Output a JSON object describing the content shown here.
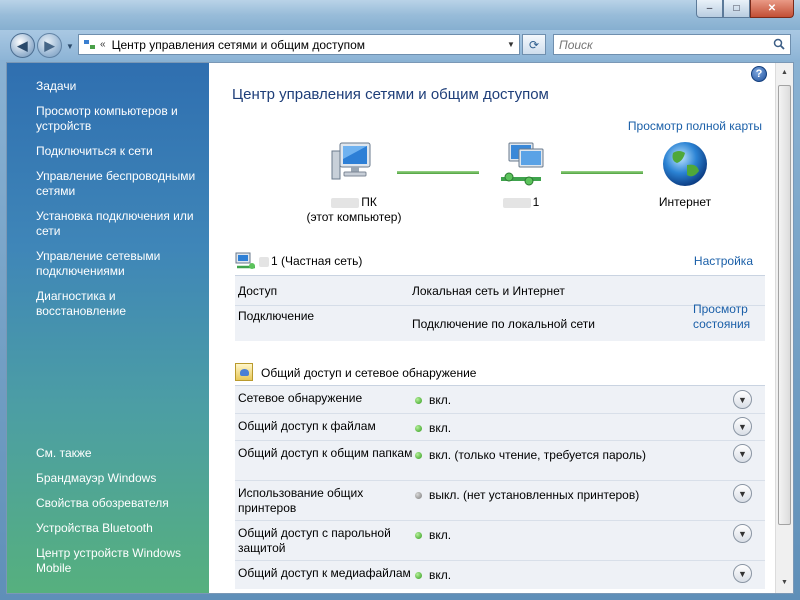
{
  "titlebar": {
    "min": "–",
    "max": "□",
    "close": "✕"
  },
  "nav": {
    "back": "◀",
    "forward": "▶",
    "dropdown": "▼",
    "address_sep": "«",
    "address": "Центр управления сетями и общим доступом",
    "refresh": "⟳",
    "search_placeholder": "Поиск"
  },
  "sidebar": {
    "heading": "Задачи",
    "items": [
      "Просмотр компьютеров и устройств",
      "Подключиться к сети",
      "Управление беспроводными сетями",
      "Установка подключения или сети",
      "Управление сетевыми подключениями",
      "Диагностика и восстановление"
    ],
    "see_also": "См. также",
    "see_items": [
      "Брандмауэр Windows",
      "Свойства обозревателя",
      "Устройства Bluetooth",
      "Центр устройств Windows Mobile"
    ]
  },
  "main": {
    "help": "?",
    "title": "Центр управления сетями и общим доступом",
    "full_map": "Просмотр полной карты",
    "map": {
      "pc_name": "ПК",
      "pc_sub": "(этот компьютер)",
      "net_name": "1",
      "internet": "Интернет"
    },
    "network": {
      "name": "1 (Частная сеть)",
      "customize": "Настройка",
      "access_label": "Доступ",
      "access_value": "Локальная сеть и Интернет",
      "connection_label": "Подключение",
      "connection_value": "Подключение по локальной сети",
      "view_status": "Просмотр состояния"
    },
    "sharing": {
      "title": "Общий доступ и сетевое обнаружение",
      "rows": [
        {
          "label": "Сетевое обнаружение",
          "value": "вкл.",
          "state": "on"
        },
        {
          "label": "Общий доступ к файлам",
          "value": "вкл.",
          "state": "on"
        },
        {
          "label": "Общий доступ к общим папкам",
          "value": "вкл. (только чтение, требуется пароль)",
          "state": "on"
        },
        {
          "label": "Использование общих принтеров",
          "value": "выкл. (нет установленных принтеров)",
          "state": "off"
        },
        {
          "label": "Общий доступ с парольной защитой",
          "value": "вкл.",
          "state": "on"
        },
        {
          "label": "Общий доступ к медиафайлам",
          "value": "вкл.",
          "state": "on"
        }
      ]
    }
  },
  "colors": {
    "link": "#1a5fa8",
    "title": "#1e3e79",
    "on": "#2f9a1c",
    "off": "#7a7a7a"
  }
}
